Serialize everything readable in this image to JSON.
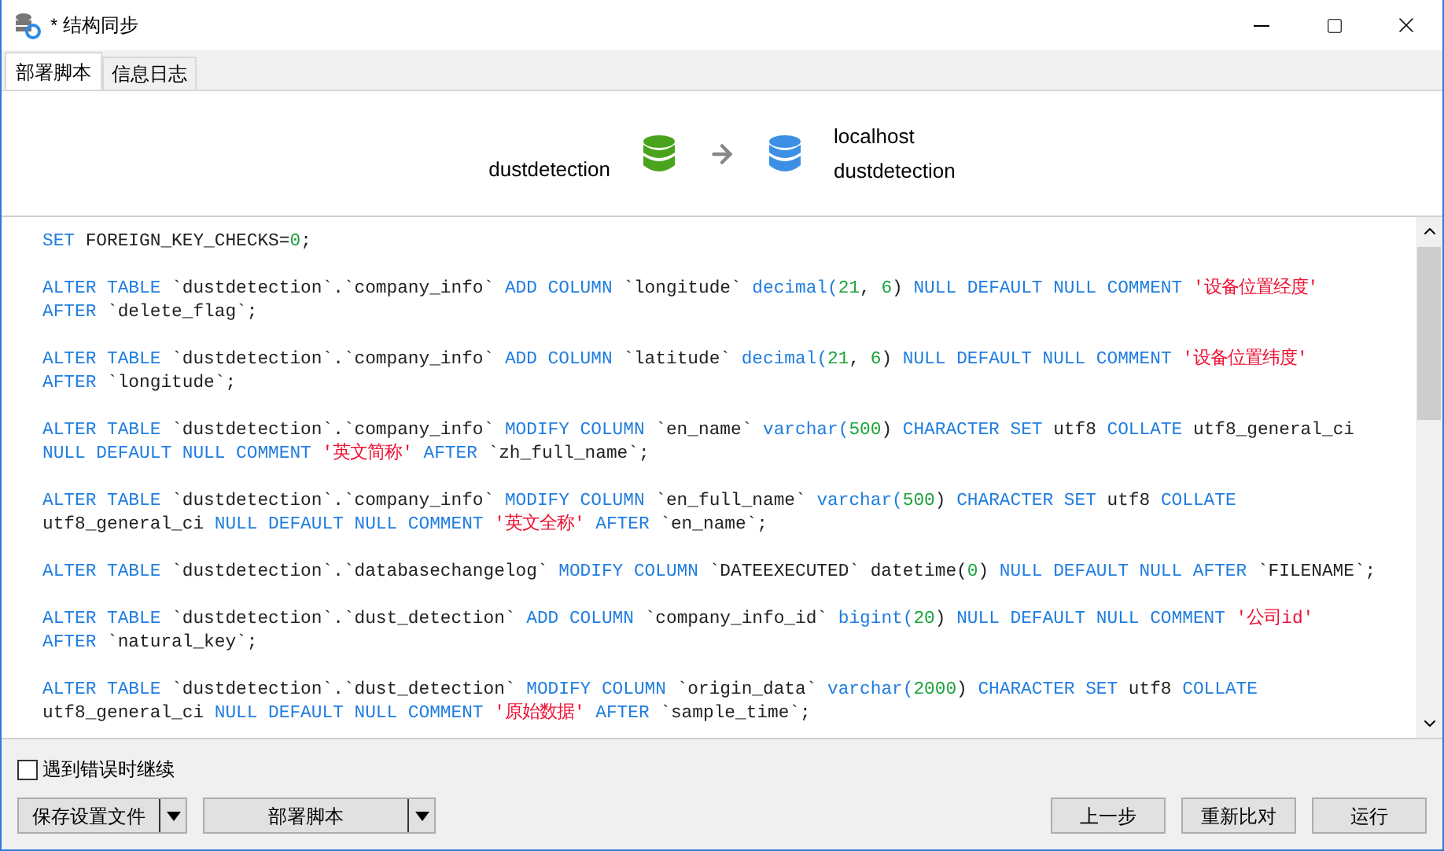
{
  "window": {
    "title": "* 结构同步"
  },
  "tabs": [
    {
      "label": "部署脚本",
      "selected": true
    },
    {
      "label": "信息日志",
      "selected": false
    }
  ],
  "source": {
    "database": "dustdetection"
  },
  "target": {
    "host": "localhost",
    "database": "dustdetection"
  },
  "script": [
    [
      [
        {
          "kind": "kw",
          "text": "SET "
        },
        {
          "kind": "id",
          "text": "FOREIGN_KEY_CHECKS="
        },
        {
          "kind": "num",
          "text": "0"
        },
        {
          "kind": "id",
          "text": ";"
        }
      ]
    ],
    [
      [
        {
          "kind": "kw",
          "text": "ALTER TABLE "
        },
        {
          "kind": "id",
          "text": "`dustdetection`.`company_info` "
        },
        {
          "kind": "kw",
          "text": "ADD COLUMN "
        },
        {
          "kind": "id",
          "text": "`longitude` "
        },
        {
          "kind": "kw",
          "text": "decimal("
        },
        {
          "kind": "num",
          "text": "21"
        },
        {
          "kind": "id",
          "text": ", "
        },
        {
          "kind": "num",
          "text": "6"
        },
        {
          "kind": "id",
          "text": ") "
        },
        {
          "kind": "kw",
          "text": "NULL DEFAULT NULL COMMENT "
        },
        {
          "kind": "str",
          "text": "'设备位置经度'"
        }
      ],
      [
        {
          "kind": "kw",
          "text": "AFTER "
        },
        {
          "kind": "id",
          "text": "`delete_flag`;"
        }
      ]
    ],
    [
      [
        {
          "kind": "kw",
          "text": "ALTER TABLE "
        },
        {
          "kind": "id",
          "text": "`dustdetection`.`company_info` "
        },
        {
          "kind": "kw",
          "text": "ADD COLUMN "
        },
        {
          "kind": "id",
          "text": "`latitude` "
        },
        {
          "kind": "kw",
          "text": "decimal("
        },
        {
          "kind": "num",
          "text": "21"
        },
        {
          "kind": "id",
          "text": ", "
        },
        {
          "kind": "num",
          "text": "6"
        },
        {
          "kind": "id",
          "text": ") "
        },
        {
          "kind": "kw",
          "text": "NULL DEFAULT NULL COMMENT "
        },
        {
          "kind": "str",
          "text": "'设备位置纬度'"
        }
      ],
      [
        {
          "kind": "kw",
          "text": "AFTER "
        },
        {
          "kind": "id",
          "text": "`longitude`;"
        }
      ]
    ],
    [
      [
        {
          "kind": "kw",
          "text": "ALTER TABLE "
        },
        {
          "kind": "id",
          "text": "`dustdetection`.`company_info` "
        },
        {
          "kind": "kw",
          "text": "MODIFY COLUMN "
        },
        {
          "kind": "id",
          "text": "`en_name` "
        },
        {
          "kind": "kw",
          "text": "varchar("
        },
        {
          "kind": "num",
          "text": "500"
        },
        {
          "kind": "id",
          "text": ") "
        },
        {
          "kind": "kw",
          "text": "CHARACTER SET "
        },
        {
          "kind": "id",
          "text": "utf8 "
        },
        {
          "kind": "kw",
          "text": "COLLATE "
        },
        {
          "kind": "id",
          "text": "utf8_general_ci"
        }
      ],
      [
        {
          "kind": "kw",
          "text": "NULL DEFAULT NULL COMMENT "
        },
        {
          "kind": "str",
          "text": "'英文简称' "
        },
        {
          "kind": "kw",
          "text": "AFTER "
        },
        {
          "kind": "id",
          "text": "`zh_full_name`;"
        }
      ]
    ],
    [
      [
        {
          "kind": "kw",
          "text": "ALTER TABLE "
        },
        {
          "kind": "id",
          "text": "`dustdetection`.`company_info` "
        },
        {
          "kind": "kw",
          "text": "MODIFY COLUMN "
        },
        {
          "kind": "id",
          "text": "`en_full_name` "
        },
        {
          "kind": "kw",
          "text": "varchar("
        },
        {
          "kind": "num",
          "text": "500"
        },
        {
          "kind": "id",
          "text": ") "
        },
        {
          "kind": "kw",
          "text": "CHARACTER SET "
        },
        {
          "kind": "id",
          "text": "utf8 "
        },
        {
          "kind": "kw",
          "text": "COLLATE"
        }
      ],
      [
        {
          "kind": "id",
          "text": "utf8_general_ci "
        },
        {
          "kind": "kw",
          "text": "NULL DEFAULT NULL COMMENT "
        },
        {
          "kind": "str",
          "text": "'英文全称' "
        },
        {
          "kind": "kw",
          "text": "AFTER "
        },
        {
          "kind": "id",
          "text": "`en_name`;"
        }
      ]
    ],
    [
      [
        {
          "kind": "kw",
          "text": "ALTER TABLE "
        },
        {
          "kind": "id",
          "text": "`dustdetection`.`databasechangelog` "
        },
        {
          "kind": "kw",
          "text": "MODIFY COLUMN "
        },
        {
          "kind": "id",
          "text": "`DATEEXECUTED` datetime("
        },
        {
          "kind": "num",
          "text": "0"
        },
        {
          "kind": "id",
          "text": ") "
        },
        {
          "kind": "kw",
          "text": "NULL DEFAULT NULL AFTER "
        },
        {
          "kind": "id",
          "text": "`FILENAME`;"
        }
      ]
    ],
    [
      [
        {
          "kind": "kw",
          "text": "ALTER TABLE "
        },
        {
          "kind": "id",
          "text": "`dustdetection`.`dust_detection` "
        },
        {
          "kind": "kw",
          "text": "ADD COLUMN "
        },
        {
          "kind": "id",
          "text": "`company_info_id` "
        },
        {
          "kind": "kw",
          "text": "bigint("
        },
        {
          "kind": "num",
          "text": "20"
        },
        {
          "kind": "id",
          "text": ") "
        },
        {
          "kind": "kw",
          "text": "NULL DEFAULT NULL COMMENT "
        },
        {
          "kind": "str",
          "text": "'公司id'"
        }
      ],
      [
        {
          "kind": "kw",
          "text": "AFTER "
        },
        {
          "kind": "id",
          "text": "`natural_key`;"
        }
      ]
    ],
    [
      [
        {
          "kind": "kw",
          "text": "ALTER TABLE "
        },
        {
          "kind": "id",
          "text": "`dustdetection`.`dust_detection` "
        },
        {
          "kind": "kw",
          "text": "MODIFY COLUMN "
        },
        {
          "kind": "id",
          "text": "`origin_data` "
        },
        {
          "kind": "kw",
          "text": "varchar("
        },
        {
          "kind": "num",
          "text": "2000"
        },
        {
          "kind": "id",
          "text": ") "
        },
        {
          "kind": "kw",
          "text": "CHARACTER SET "
        },
        {
          "kind": "id",
          "text": "utf8 "
        },
        {
          "kind": "kw",
          "text": "COLLATE"
        }
      ],
      [
        {
          "kind": "id",
          "text": "utf8_general_ci "
        },
        {
          "kind": "kw",
          "text": "NULL DEFAULT NULL COMMENT "
        },
        {
          "kind": "str",
          "text": "'原始数据' "
        },
        {
          "kind": "kw",
          "text": "AFTER "
        },
        {
          "kind": "id",
          "text": "`sample_time`;"
        }
      ]
    ]
  ],
  "continue_on_error": {
    "label": "遇到错误时继续",
    "checked": false
  },
  "left_buttons": [
    {
      "label": "保存设置文件"
    },
    {
      "label": "部署脚本"
    }
  ],
  "right_buttons": [
    {
      "label": "上一步"
    },
    {
      "label": "重新比对"
    },
    {
      "label": "运行"
    }
  ]
}
